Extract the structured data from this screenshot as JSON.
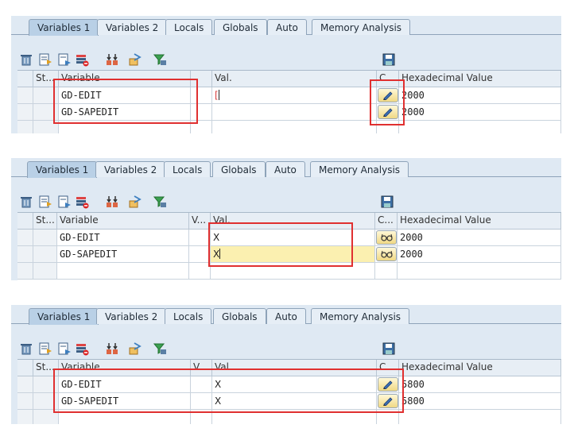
{
  "tabs": [
    "Variables 1",
    "Variables 2",
    "Locals",
    "Globals",
    "Auto",
    "Memory Analysis"
  ],
  "active_tab": "Variables 1",
  "toolbar_icons": [
    "delete-icon",
    "details-icon",
    "new-entry-icon",
    "remove-entry-icon",
    "import-icon",
    "export-icon",
    "filter-icon",
    "save-icon"
  ],
  "panels": [
    {
      "columns": {
        "status": "St...",
        "variable": "Variable",
        "view": "",
        "value": "Val.",
        "change": "C...",
        "hex": "Hexadecimal Value"
      },
      "rows": [
        {
          "variable": "GD-EDIT",
          "value": "",
          "hex": "2000"
        },
        {
          "variable": "GD-SAPEDIT",
          "value": "",
          "hex": "2000"
        }
      ]
    },
    {
      "columns": {
        "status": "St...",
        "variable": "Variable",
        "view": "V...",
        "value": "Val.",
        "change": "C...",
        "hex": "Hexadecimal Value"
      },
      "rows": [
        {
          "variable": "GD-EDIT",
          "value": "X",
          "hex": "2000"
        },
        {
          "variable": "GD-SAPEDIT",
          "value": "X",
          "hex": "2000"
        }
      ]
    },
    {
      "columns": {
        "status": "St...",
        "variable": "Variable",
        "view": "V...",
        "value": "Val.",
        "change": "C...",
        "hex": "Hexadecimal Value"
      },
      "rows": [
        {
          "variable": "GD-EDIT",
          "value": "X",
          "hex": "5800"
        },
        {
          "variable": "GD-SAPEDIT",
          "value": "X",
          "hex": "5800"
        }
      ]
    }
  ],
  "colors": {
    "highlight": "#e03030",
    "panel_bg": "#dfe9f3",
    "active_tab": "#b9d0e6",
    "edit_field": "#fbf0b0"
  }
}
